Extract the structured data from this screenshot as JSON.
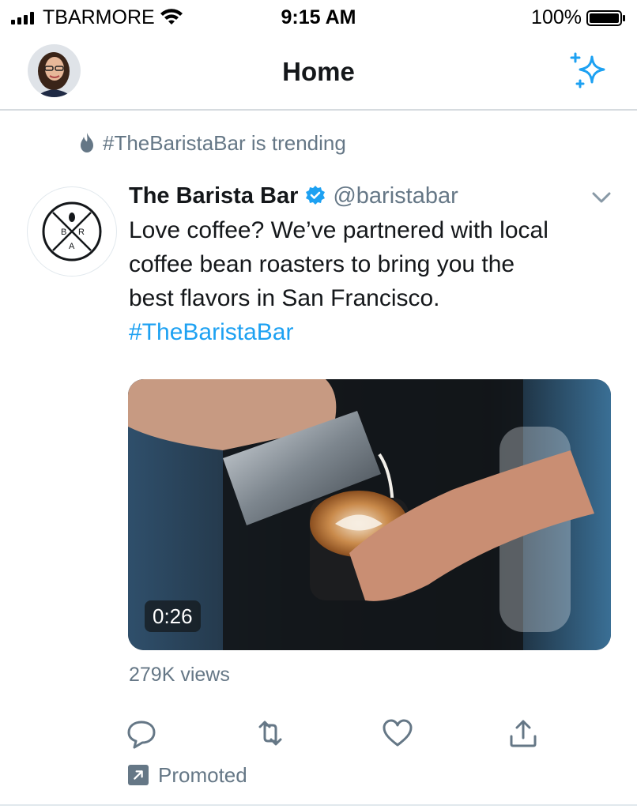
{
  "status_bar": {
    "carrier": "TBARMORE",
    "time": "9:15 AM",
    "battery_percent": "100%",
    "signal_bars": 4,
    "battery_level": 1.0
  },
  "nav": {
    "title": "Home",
    "sparkle_icon": "sparkle-icon",
    "accent_color": "#1da1f2"
  },
  "tweet": {
    "social_context": "#TheBaristaBar is trending",
    "social_context_icon": "flame-icon",
    "author_name": "The Barista Bar",
    "author_handle": "@baristabar",
    "verified": true,
    "body_lines": [
      "Love coffee? We’ve partnered with local",
      "coffee bean roasters to bring you the",
      "best flavors in San Francisco."
    ],
    "hashtag": "#TheBaristaBar",
    "video_duration": "0:26",
    "views": "279K views",
    "actions": [
      "reply-icon",
      "retweet-icon",
      "like-icon",
      "share-icon"
    ],
    "promoted_label": "Promoted",
    "colors": {
      "text": "#14171a",
      "secondary": "#657786",
      "link": "#1da1f2"
    }
  }
}
